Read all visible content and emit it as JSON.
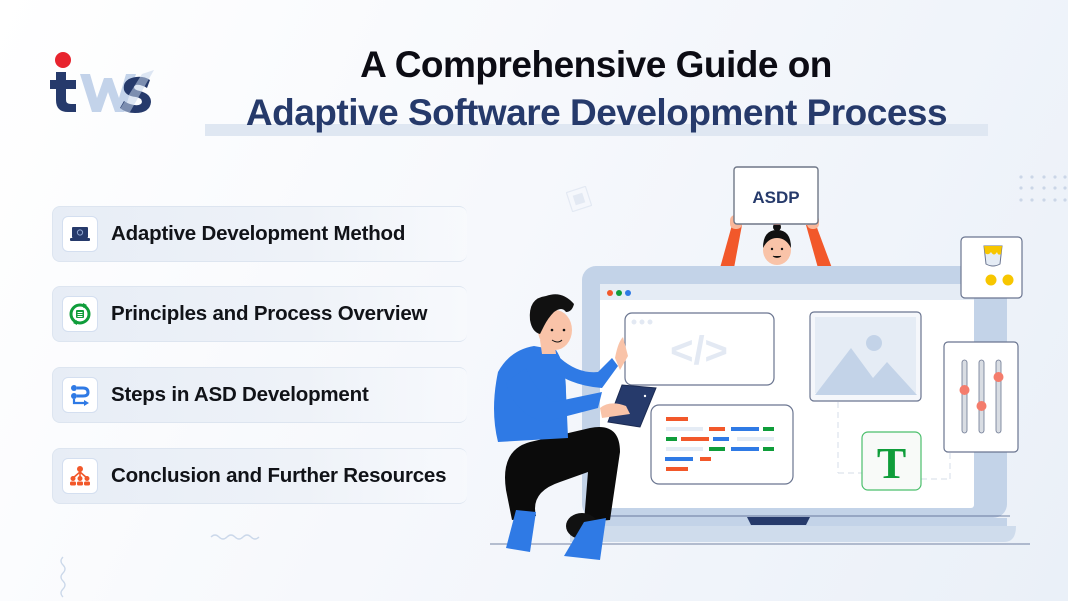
{
  "brand": {
    "logo_text": "tws",
    "colors": {
      "navy": "#263a6b",
      "red": "#e8242e",
      "light_blue": "#c3d3ea"
    }
  },
  "header": {
    "title_line1": "A Comprehensive Guide on",
    "title_line2": "Adaptive Software Development Process"
  },
  "menu": {
    "items": [
      {
        "label": "Adaptive Development Method",
        "icon": "laptop-icon",
        "icon_color": "#263a6b"
      },
      {
        "label": "Principles and Process Overview",
        "icon": "cycle-list-icon",
        "icon_color": "#0f9d3a"
      },
      {
        "label": "Steps in ASD Development",
        "icon": "workflow-icon",
        "icon_color": "#2f7ae5"
      },
      {
        "label": "Conclusion and Further Resources",
        "icon": "team-hierarchy-icon",
        "icon_color": "#f2582a"
      }
    ]
  },
  "illustration": {
    "sign_text": "ASDP",
    "code_glyph": "</>",
    "font_glyph": "T",
    "window_dot_colors": [
      "#f2582a",
      "#0f9d3a",
      "#2f7ae5"
    ],
    "accent_colors": {
      "orange": "#f2582a",
      "green": "#0f9d3a",
      "blue": "#2f7ae5",
      "yellow": "#f7c600",
      "slider": "#f47c6c"
    }
  }
}
